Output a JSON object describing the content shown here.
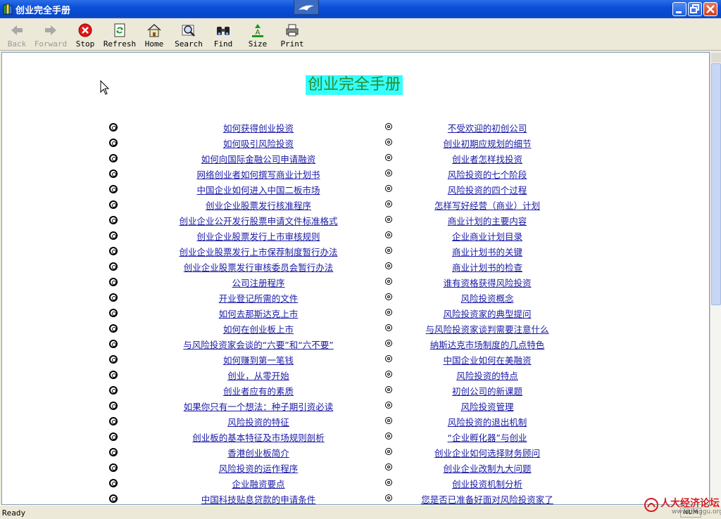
{
  "window": {
    "title": "创业完全手册"
  },
  "toolbar": {
    "buttons": [
      {
        "label": "Back",
        "icon": "back-arrow-icon",
        "enabled": false
      },
      {
        "label": "Forward",
        "icon": "forward-arrow-icon",
        "enabled": false
      },
      {
        "label": "Stop",
        "icon": "stop-icon",
        "enabled": true
      },
      {
        "label": "Refresh",
        "icon": "refresh-icon",
        "enabled": true
      },
      {
        "label": "Home",
        "icon": "home-icon",
        "enabled": true
      },
      {
        "label": "Search",
        "icon": "search-icon",
        "enabled": true
      },
      {
        "label": "Find",
        "icon": "binoculars-icon",
        "enabled": true
      },
      {
        "label": "Size",
        "icon": "font-size-icon",
        "enabled": true
      },
      {
        "label": "Print",
        "icon": "print-icon",
        "enabled": true
      }
    ]
  },
  "page": {
    "heading": "创业完全手册",
    "left_links": [
      "如何获得创业投资",
      "如何吸引风险投资",
      "如何向国际金融公司申请融资",
      "网络创业者如何撰写商业计划书",
      "中国企业如何进入中国二板市场",
      "创业企业股票发行核准程序",
      "创业企业公开发行股票申请文件标准格式",
      "创业企业股票发行上市审核规则",
      "创业企业股票发行上市保荐制度暂行办法",
      "创业企业股票发行审核委员会暂行办法",
      "公司注册程序",
      "开业登记所需的文件",
      "如何去那斯达克上市",
      "如何在创业板上市",
      "与风险投资家会谈的“六要”和“六不要”",
      "如何赚到第一笔钱",
      "创业，从零开始",
      "创业者应有的素质",
      "如果你只有一个想法：种子期引资必读",
      "风险投资的特征",
      "创业板的基本特征及市场规则剖析",
      "香港创业板简介",
      "风险投资的运作程序",
      "企业融资要点",
      "中国科技贴息贷款的申请条件"
    ],
    "right_links": [
      "不受欢迎的初创公司",
      "创业初期应规划的细节",
      "创业者怎样找投资",
      "风险投资的七个阶段",
      "风险投资的四个过程",
      "怎样写好经营（商业）计划",
      "商业计划的主要内容",
      "企业商业计划目录",
      "商业计划书的关键",
      "商业计划书的检查",
      "谁有资格获得风险投资",
      "风险投资概念",
      "风险投资家的典型提问",
      "与风险投资家谈判需要注意什么",
      "纳斯达克市场制度的几点特色",
      "中国企业如何在美融资",
      "风险投资的特点",
      "初创公司的新课题",
      "风险投资管理",
      "风险投资的退出机制",
      "“企业孵化器”与创业",
      "创业企业如何选择财务顾问",
      "创业企业改制九大问题",
      "创业投资机制分析",
      "您是否已准备好面对风险投资家了"
    ]
  },
  "status": {
    "text": "Ready",
    "indicator": "NUM"
  },
  "watermark": {
    "title": "人大经济论坛",
    "url": "www.pinggu.org"
  },
  "colors": {
    "titlebar": "#0a4fd8",
    "heading_bg": "#33ffff",
    "heading_text": "#2d8a2d",
    "link": "#1a1aa6"
  }
}
